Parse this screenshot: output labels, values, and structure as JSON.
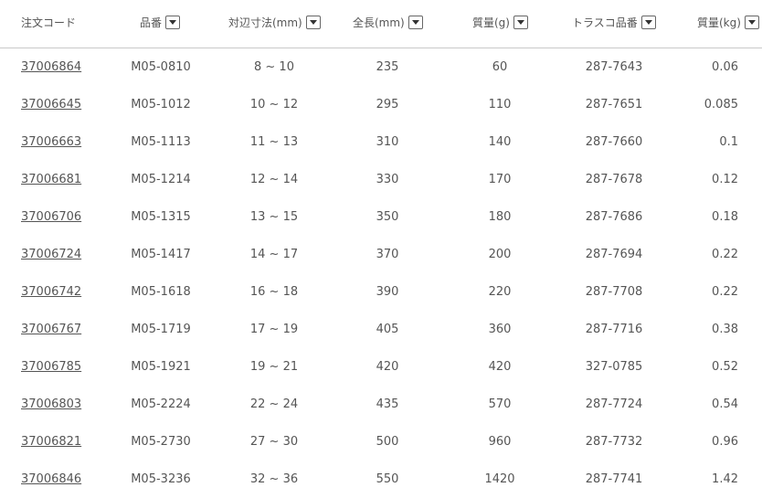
{
  "headers": {
    "order_code": "注文コード",
    "part_no": "品番",
    "size": "対辺寸法(mm)",
    "length": "全長(mm)",
    "mass_g": "質量(g)",
    "trusco_no": "トラスコ品番",
    "mass_kg": "質量(kg)"
  },
  "icons": {
    "dropdown": "chevron-down-icon"
  },
  "rows": [
    {
      "code": "37006864",
      "part": "M05-0810",
      "size": "8 ~ 10",
      "length": "235",
      "mass_g": "60",
      "trusco": "287-7643",
      "mass_kg": "0.06"
    },
    {
      "code": "37006645",
      "part": "M05-1012",
      "size": "10 ~ 12",
      "length": "295",
      "mass_g": "110",
      "trusco": "287-7651",
      "mass_kg": "0.085"
    },
    {
      "code": "37006663",
      "part": "M05-1113",
      "size": "11 ~ 13",
      "length": "310",
      "mass_g": "140",
      "trusco": "287-7660",
      "mass_kg": "0.1"
    },
    {
      "code": "37006681",
      "part": "M05-1214",
      "size": "12 ~ 14",
      "length": "330",
      "mass_g": "170",
      "trusco": "287-7678",
      "mass_kg": "0.12"
    },
    {
      "code": "37006706",
      "part": "M05-1315",
      "size": "13 ~ 15",
      "length": "350",
      "mass_g": "180",
      "trusco": "287-7686",
      "mass_kg": "0.18"
    },
    {
      "code": "37006724",
      "part": "M05-1417",
      "size": "14 ~ 17",
      "length": "370",
      "mass_g": "200",
      "trusco": "287-7694",
      "mass_kg": "0.22"
    },
    {
      "code": "37006742",
      "part": "M05-1618",
      "size": "16 ~ 18",
      "length": "390",
      "mass_g": "220",
      "trusco": "287-7708",
      "mass_kg": "0.22"
    },
    {
      "code": "37006767",
      "part": "M05-1719",
      "size": "17 ~ 19",
      "length": "405",
      "mass_g": "360",
      "trusco": "287-7716",
      "mass_kg": "0.38"
    },
    {
      "code": "37006785",
      "part": "M05-1921",
      "size": "19 ~ 21",
      "length": "420",
      "mass_g": "420",
      "trusco": "327-0785",
      "mass_kg": "0.52"
    },
    {
      "code": "37006803",
      "part": "M05-2224",
      "size": "22 ~ 24",
      "length": "435",
      "mass_g": "570",
      "trusco": "287-7724",
      "mass_kg": "0.54"
    },
    {
      "code": "37006821",
      "part": "M05-2730",
      "size": "27 ~ 30",
      "length": "500",
      "mass_g": "960",
      "trusco": "287-7732",
      "mass_kg": "0.96"
    },
    {
      "code": "37006846",
      "part": "M05-3236",
      "size": "32 ~ 36",
      "length": "550",
      "mass_g": "1420",
      "trusco": "287-7741",
      "mass_kg": "1.42"
    }
  ]
}
